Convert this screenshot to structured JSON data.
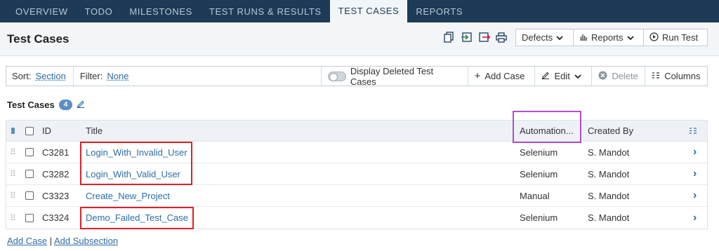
{
  "nav": {
    "tabs": [
      "OVERVIEW",
      "TODO",
      "MILESTONES",
      "TEST RUNS & RESULTS",
      "TEST CASES",
      "REPORTS"
    ],
    "active": "TEST CASES"
  },
  "header": {
    "title": "Test Cases",
    "defects_label": "Defects",
    "reports_label": "Reports",
    "run_test_label": "Run Test"
  },
  "toolbar": {
    "sort_label": "Sort:",
    "sort_value": "Section",
    "filter_label": "Filter:",
    "filter_value": "None",
    "display_deleted_label": "Display Deleted Test Cases",
    "add_case_label": "Add Case",
    "edit_label": "Edit",
    "delete_label": "Delete",
    "columns_label": "Columns"
  },
  "section": {
    "title": "Test Cases",
    "count": "4"
  },
  "table": {
    "headers": {
      "id": "ID",
      "title": "Title",
      "automation": "Automation...",
      "created_by": "Created By"
    },
    "rows": [
      {
        "id": "C3281",
        "title": "Login_With_Invalid_User",
        "automation": "Selenium",
        "created_by": "S. Mandot"
      },
      {
        "id": "C3282",
        "title": "Login_With_Valid_User",
        "automation": "Selenium",
        "created_by": "S. Mandot"
      },
      {
        "id": "C3323",
        "title": "Create_New_Project",
        "automation": "Manual",
        "created_by": "S. Mandot"
      },
      {
        "id": "C3324",
        "title": "Demo_Failed_Test_Case",
        "automation": "Selenium",
        "created_by": "S. Mandot"
      }
    ]
  },
  "footer": {
    "add_case": "Add Case",
    "separator": "|",
    "add_subsection": "Add Subsection"
  },
  "colors": {
    "nav_bg": "#1d3a56",
    "link": "#2e6da4",
    "highlight_red": "#e0202a",
    "highlight_purple": "#b04fc8"
  }
}
